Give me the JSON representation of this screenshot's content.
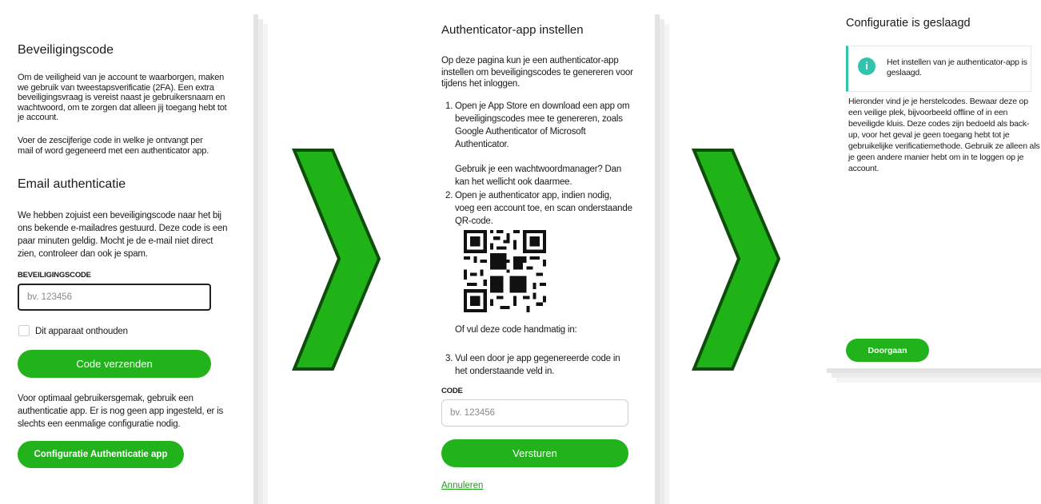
{
  "panel1": {
    "title": "Beveiligingscode",
    "intro": "Om de veiligheid van je account te waarborgen, maken we gebruik van tweestapsverificatie (2FA). Een extra beveiligingsvraag is vereist naast je gebruikersnaam en wachtwoord, om te zorgen dat alleen jij toegang hebt tot je account.",
    "intro2": "Voer de zescijferige code in welke je ontvangt per mail of word gegeneerd met een authenticator app.",
    "subtitle": "Email authenticatie",
    "email_text": "We hebben zojuist een beveiligingscode naar het bij ons bekende e-mailadres gestuurd. Deze code is een paar minuten geldig. Mocht je de e-mail niet direct zien, controleer dan ook je spam.",
    "code_label": "BEVEILIGINGSCODE",
    "code_placeholder": "bv. 123456",
    "remember_label": "Dit apparaat onthouden",
    "submit_label": "Code verzenden",
    "app_text": "Voor optimaal gebruikersgemak, gebruik een authenticatie app. Er is nog geen app ingesteld, er is slechts een eenmalige configuratie nodig.",
    "config_label": "Configuratie Authenticatie app"
  },
  "panel2": {
    "title": "Authenticator-app instellen",
    "intro": "Op deze pagina kun je een authenticator-app instellen om beveiligingscodes te genereren voor tijdens het inloggen.",
    "step1_num": "1.",
    "step1": "Open je App Store en download een app om beveiligingscodes mee te genereren, zoals Google Authenticator of Microsoft Authenticator.",
    "step1_note": "Gebruik je een wachtwoordmanager? Dan kan het wellicht ook daarmee.",
    "step2_num": "2.",
    "step2": "Open je authenticator app, indien nodig, voeg een account toe, en scan onderstaande QR-code.",
    "manual_text": "Of vul deze code handmatig in:",
    "step3_num": "3.",
    "step3": "Vul een door je app gegenereerde code in het onderstaande veld in.",
    "code_label": "CODE",
    "code_placeholder": "bv. 123456",
    "submit_label": "Versturen",
    "cancel_label": "Annuleren"
  },
  "panel3": {
    "title": "Configuratie is geslaagd",
    "info_icon": "i",
    "info_text": "Het instellen van je authenticator-app is geslaagd.",
    "body": "Hieronder vind je je herstelcodes. Bewaar deze op een veilige plek, bijvoorbeeld offline of in een beveiligde kluis. Deze codes zijn bedoeld als back-up, voor het geval je geen toegang hebt tot je gebruikelijke verificatiemethode. Gebruik ze alleen als je geen andere manier hebt om in te loggen op je account.",
    "continue_label": "Doorgaan"
  },
  "colors": {
    "accent": "#22b31c",
    "arrow_fill": "#1fb318",
    "arrow_stroke": "#0f4d0d",
    "info": "#2fc4ad"
  },
  "icons": [
    "info-icon",
    "qr-code-icon",
    "next-step-arrow-icon"
  ]
}
